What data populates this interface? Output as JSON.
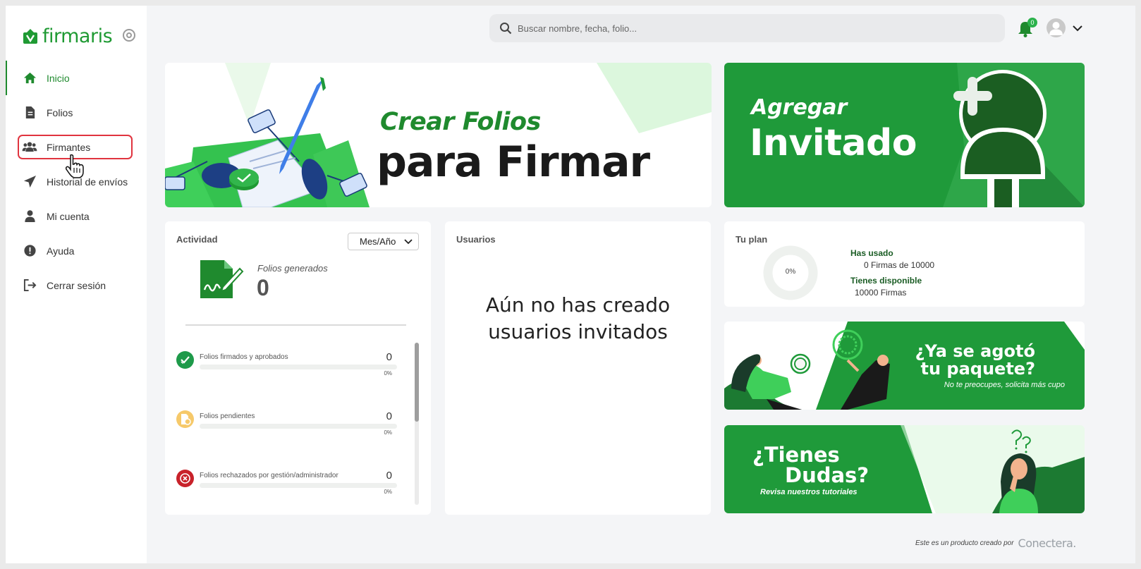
{
  "brand": {
    "name": "firmaris",
    "color": "#1f9a33"
  },
  "sidebar": {
    "items": [
      {
        "label": "Inicio",
        "icon": "home-icon",
        "active": true
      },
      {
        "label": "Folios",
        "icon": "document-icon",
        "active": false
      },
      {
        "label": "Firmantes",
        "icon": "users-icon",
        "active": false
      },
      {
        "label": "Historial de envíos",
        "icon": "send-icon",
        "active": false
      },
      {
        "label": "Mi cuenta",
        "icon": "user-icon",
        "active": false
      },
      {
        "label": "Ayuda",
        "icon": "info-icon",
        "active": false
      },
      {
        "label": "Cerrar sesión",
        "icon": "logout-icon",
        "active": false
      }
    ]
  },
  "topbar": {
    "search_placeholder": "Buscar nombre, fecha, folio...",
    "notifications_count": "0"
  },
  "banners": {
    "crear": {
      "line1": "Crear Folios",
      "line2": "para Firmar"
    },
    "invitado": {
      "line1": "Agregar",
      "line2": "Invitado"
    },
    "paquete": {
      "line1": "¿Ya se agotó",
      "line2": "tu paquete?",
      "line3": "No te preocupes, solicita más cupo"
    },
    "dudas": {
      "line1": "¿Tienes",
      "line2": "Dudas?",
      "line3": "Revisa nuestros tutoriales"
    }
  },
  "actividad": {
    "title": "Actividad",
    "period": "Mes/Año",
    "generated_label": "Folios generados",
    "generated_value": "0",
    "stats": [
      {
        "label": "Folios firmados y aprobados",
        "value": "0",
        "pct": "0%",
        "color": "#1e9a4a",
        "icon": "check-icon"
      },
      {
        "label": "Folios pendientes",
        "value": "0",
        "pct": "0%",
        "color": "#f6c96a",
        "icon": "clock-document-icon"
      },
      {
        "label": "Folios rechazados por gestión/administrador",
        "value": "0",
        "pct": "0%",
        "color": "#c8222a",
        "icon": "close-circle-icon"
      }
    ]
  },
  "usuarios": {
    "title": "Usuarios",
    "empty_line1": "Aún no has creado",
    "empty_line2": "usuarios invitados"
  },
  "plan": {
    "title": "Tu plan",
    "ring_label": "0%",
    "used_fraction": 0,
    "used_heading": "Has usado",
    "used_value": "0 Firmas de 10000",
    "available_heading": "Tienes disponible",
    "available_value": "10000 Firmas"
  },
  "footer": {
    "text": "Este es un producto creado por",
    "brand": "Conectera."
  }
}
